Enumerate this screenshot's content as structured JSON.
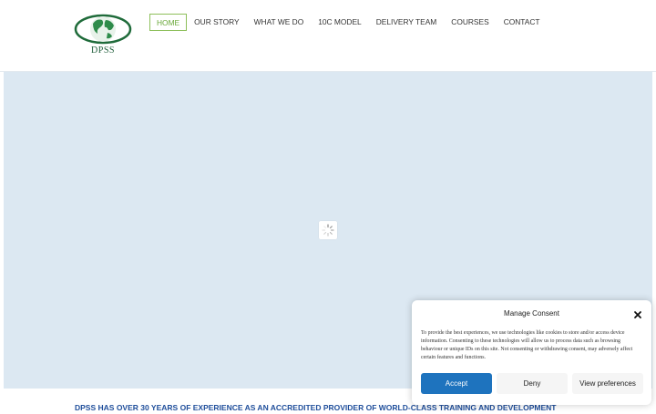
{
  "brand": {
    "logo_text": "DPSS"
  },
  "nav": {
    "items": [
      {
        "label": "HOME",
        "active": true
      },
      {
        "label": "OUR STORY"
      },
      {
        "label": "WHAT WE DO"
      },
      {
        "label": "10C MODEL"
      },
      {
        "label": "DELIVERY TEAM"
      },
      {
        "label": "COURSES"
      },
      {
        "label": "CONTACT"
      }
    ]
  },
  "banner": {
    "text": "DPSS HAS OVER 30 YEARS OF EXPERIENCE AS AN ACCREDITED PROVIDER OF WORLD-CLASS TRAINING AND DEVELOPMENT"
  },
  "consent": {
    "title": "Manage Consent",
    "body": "To provide the best experiences, we use technologies like cookies to store and/or access device information. Consenting to these technologies will allow us to process data such as browsing behaviour or unique IDs on this site. Not consenting or withdrawing consent, may adversely affect certain features and functions.",
    "accept_label": "Accept",
    "deny_label": "Deny",
    "prefs_label": "View preferences"
  },
  "colors": {
    "accent_green": "#8dbf5a",
    "hero_bg": "#dce8f2",
    "button_blue": "#1e73be"
  }
}
